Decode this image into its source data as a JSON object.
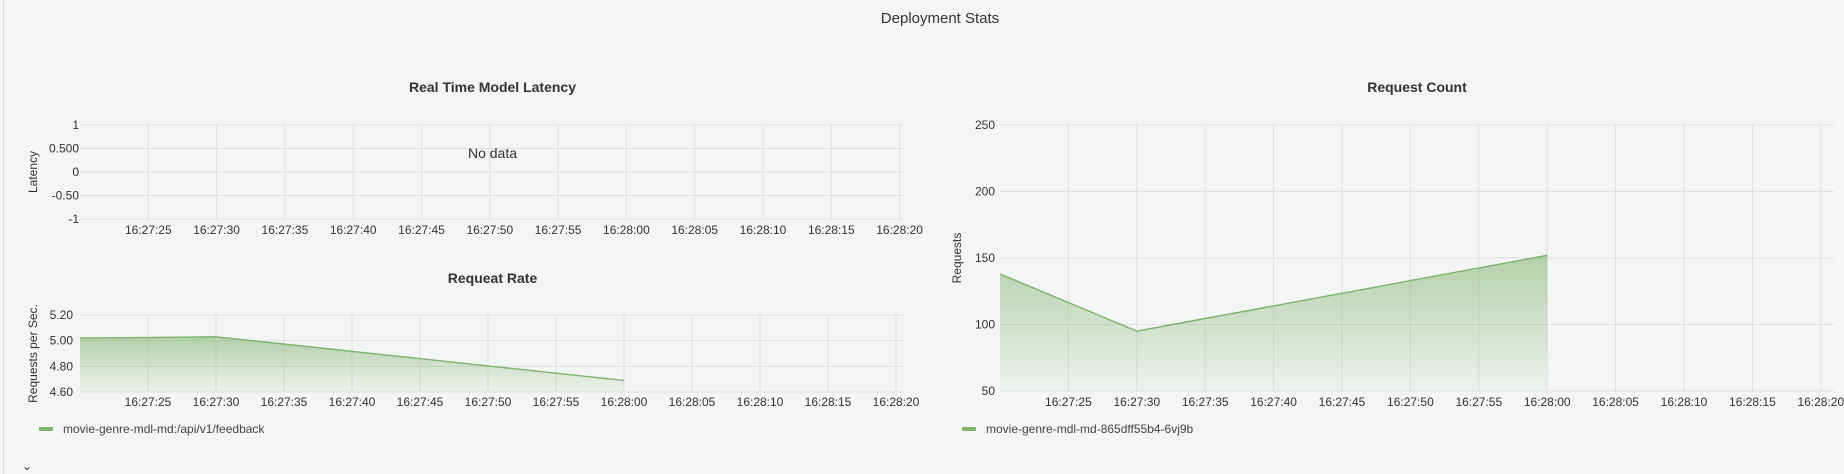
{
  "page": {
    "title": "Deployment Stats"
  },
  "colors": {
    "series": "#7eb26d",
    "grid": "#e0e0e0"
  },
  "icons": {
    "collapse": "chevron-down-icon"
  },
  "chart_data": [
    {
      "id": "latency",
      "type": "line",
      "title": "Real Time Model Latency",
      "xlabel": "",
      "ylabel": "Latency",
      "x_ticks": [
        "16:27:25",
        "16:27:30",
        "16:27:35",
        "16:27:40",
        "16:27:45",
        "16:27:50",
        "16:27:55",
        "16:28:00",
        "16:28:05",
        "16:28:10",
        "16:28:15",
        "16:28:20"
      ],
      "y_ticks": [
        "1",
        "0.500",
        "0",
        "-0.50",
        "-1"
      ],
      "ylim": [
        -1,
        1
      ],
      "series": [],
      "no_data_text": "No data",
      "grid": true
    },
    {
      "id": "request_rate",
      "type": "area",
      "title": "Requeat Rate",
      "xlabel": "",
      "ylabel": "Requests per Sec.",
      "x_ticks": [
        "16:27:25",
        "16:27:30",
        "16:27:35",
        "16:27:40",
        "16:27:45",
        "16:27:50",
        "16:27:55",
        "16:28:00",
        "16:28:05",
        "16:28:10",
        "16:28:15",
        "16:28:20"
      ],
      "y_ticks": [
        "5.20",
        "5.00",
        "4.80",
        "4.60"
      ],
      "ylim": [
        4.6,
        5.2
      ],
      "series": [
        {
          "name": "movie-genre-mdl-md:/api/v1/feedback",
          "x": [
            "16:27:20",
            "16:27:30",
            "16:28:00"
          ],
          "values": [
            5.02,
            5.03,
            4.69
          ]
        }
      ],
      "legend": "bottom-left",
      "grid": true
    },
    {
      "id": "request_count",
      "type": "area",
      "title": "Request Count",
      "xlabel": "",
      "ylabel": "Requests",
      "x_ticks": [
        "16:27:25",
        "16:27:30",
        "16:27:35",
        "16:27:40",
        "16:27:45",
        "16:27:50",
        "16:27:55",
        "16:28:00",
        "16:28:05",
        "16:28:10",
        "16:28:15",
        "16:28:20"
      ],
      "y_ticks": [
        "250",
        "200",
        "150",
        "100",
        "50"
      ],
      "ylim": [
        50,
        250
      ],
      "series": [
        {
          "name": "movie-genre-mdl-md-865dff55b4-6vj9b",
          "x": [
            "16:27:20",
            "16:27:30",
            "16:28:00"
          ],
          "values": [
            138,
            95,
            152
          ]
        }
      ],
      "legend": "bottom-left",
      "grid": true
    }
  ]
}
